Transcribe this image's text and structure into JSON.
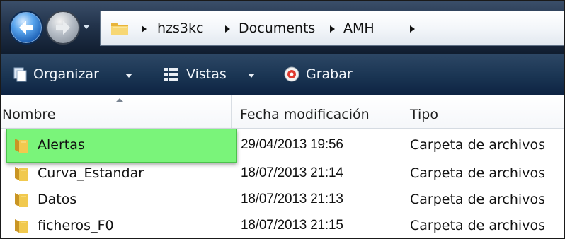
{
  "address_bar": {
    "breadcrumbs": [
      "hzs3kc",
      "Documents",
      "AMH"
    ]
  },
  "toolbar": {
    "organize_label": "Organizar",
    "views_label": "Vistas",
    "burn_label": "Grabar"
  },
  "columns": {
    "name": "Nombre",
    "modified": "Fecha modificación",
    "type": "Tipo"
  },
  "files": [
    {
      "name": "Alertas",
      "modified": "29/04/2013 19:56",
      "type": "Carpeta de archivos",
      "selected": true
    },
    {
      "name": "Curva_Estandar",
      "modified": "18/07/2013 21:14",
      "type": "Carpeta de archivos"
    },
    {
      "name": "Datos",
      "modified": "18/07/2013 21:13",
      "type": "Carpeta de archivos"
    },
    {
      "name": "ficheros_F0",
      "modified": "18/07/2013 21:15",
      "type": "Carpeta de archivos"
    }
  ],
  "colors": {
    "selection_highlight": "#7af47a",
    "toolbar_bg": "#1b3654"
  },
  "icons": [
    "back-arrow-icon",
    "forward-arrow-icon",
    "folder-icon",
    "organize-icon",
    "views-icon",
    "burn-icon"
  ]
}
